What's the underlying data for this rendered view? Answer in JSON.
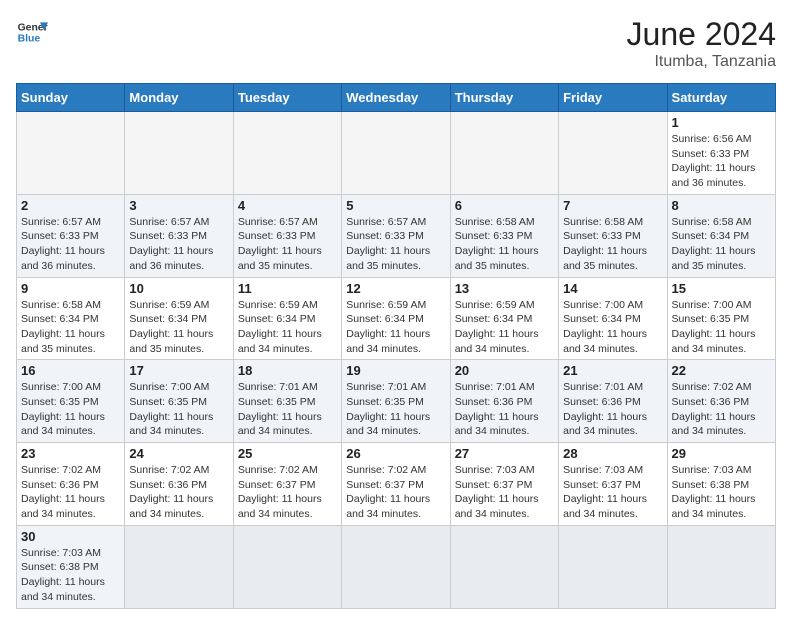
{
  "header": {
    "logo_general": "General",
    "logo_blue": "Blue",
    "month_title": "June 2024",
    "location": "Itumba, Tanzania"
  },
  "weekdays": [
    "Sunday",
    "Monday",
    "Tuesday",
    "Wednesday",
    "Thursday",
    "Friday",
    "Saturday"
  ],
  "days": [
    {
      "num": "",
      "empty": true
    },
    {
      "num": "",
      "empty": true
    },
    {
      "num": "",
      "empty": true
    },
    {
      "num": "",
      "empty": true
    },
    {
      "num": "",
      "empty": true
    },
    {
      "num": "",
      "empty": true
    },
    {
      "num": "1",
      "sunrise": "6:56 AM",
      "sunset": "6:33 PM",
      "daylight": "11 hours and 36 minutes."
    },
    {
      "num": "2",
      "sunrise": "6:57 AM",
      "sunset": "6:33 PM",
      "daylight": "11 hours and 36 minutes."
    },
    {
      "num": "3",
      "sunrise": "6:57 AM",
      "sunset": "6:33 PM",
      "daylight": "11 hours and 36 minutes."
    },
    {
      "num": "4",
      "sunrise": "6:57 AM",
      "sunset": "6:33 PM",
      "daylight": "11 hours and 35 minutes."
    },
    {
      "num": "5",
      "sunrise": "6:57 AM",
      "sunset": "6:33 PM",
      "daylight": "11 hours and 35 minutes."
    },
    {
      "num": "6",
      "sunrise": "6:58 AM",
      "sunset": "6:33 PM",
      "daylight": "11 hours and 35 minutes."
    },
    {
      "num": "7",
      "sunrise": "6:58 AM",
      "sunset": "6:33 PM",
      "daylight": "11 hours and 35 minutes."
    },
    {
      "num": "8",
      "sunrise": "6:58 AM",
      "sunset": "6:34 PM",
      "daylight": "11 hours and 35 minutes."
    },
    {
      "num": "9",
      "sunrise": "6:58 AM",
      "sunset": "6:34 PM",
      "daylight": "11 hours and 35 minutes."
    },
    {
      "num": "10",
      "sunrise": "6:59 AM",
      "sunset": "6:34 PM",
      "daylight": "11 hours and 35 minutes."
    },
    {
      "num": "11",
      "sunrise": "6:59 AM",
      "sunset": "6:34 PM",
      "daylight": "11 hours and 34 minutes."
    },
    {
      "num": "12",
      "sunrise": "6:59 AM",
      "sunset": "6:34 PM",
      "daylight": "11 hours and 34 minutes."
    },
    {
      "num": "13",
      "sunrise": "6:59 AM",
      "sunset": "6:34 PM",
      "daylight": "11 hours and 34 minutes."
    },
    {
      "num": "14",
      "sunrise": "7:00 AM",
      "sunset": "6:34 PM",
      "daylight": "11 hours and 34 minutes."
    },
    {
      "num": "15",
      "sunrise": "7:00 AM",
      "sunset": "6:35 PM",
      "daylight": "11 hours and 34 minutes."
    },
    {
      "num": "16",
      "sunrise": "7:00 AM",
      "sunset": "6:35 PM",
      "daylight": "11 hours and 34 minutes."
    },
    {
      "num": "17",
      "sunrise": "7:00 AM",
      "sunset": "6:35 PM",
      "daylight": "11 hours and 34 minutes."
    },
    {
      "num": "18",
      "sunrise": "7:01 AM",
      "sunset": "6:35 PM",
      "daylight": "11 hours and 34 minutes."
    },
    {
      "num": "19",
      "sunrise": "7:01 AM",
      "sunset": "6:35 PM",
      "daylight": "11 hours and 34 minutes."
    },
    {
      "num": "20",
      "sunrise": "7:01 AM",
      "sunset": "6:36 PM",
      "daylight": "11 hours and 34 minutes."
    },
    {
      "num": "21",
      "sunrise": "7:01 AM",
      "sunset": "6:36 PM",
      "daylight": "11 hours and 34 minutes."
    },
    {
      "num": "22",
      "sunrise": "7:02 AM",
      "sunset": "6:36 PM",
      "daylight": "11 hours and 34 minutes."
    },
    {
      "num": "23",
      "sunrise": "7:02 AM",
      "sunset": "6:36 PM",
      "daylight": "11 hours and 34 minutes."
    },
    {
      "num": "24",
      "sunrise": "7:02 AM",
      "sunset": "6:36 PM",
      "daylight": "11 hours and 34 minutes."
    },
    {
      "num": "25",
      "sunrise": "7:02 AM",
      "sunset": "6:37 PM",
      "daylight": "11 hours and 34 minutes."
    },
    {
      "num": "26",
      "sunrise": "7:02 AM",
      "sunset": "6:37 PM",
      "daylight": "11 hours and 34 minutes."
    },
    {
      "num": "27",
      "sunrise": "7:03 AM",
      "sunset": "6:37 PM",
      "daylight": "11 hours and 34 minutes."
    },
    {
      "num": "28",
      "sunrise": "7:03 AM",
      "sunset": "6:37 PM",
      "daylight": "11 hours and 34 minutes."
    },
    {
      "num": "29",
      "sunrise": "7:03 AM",
      "sunset": "6:38 PM",
      "daylight": "11 hours and 34 minutes."
    },
    {
      "num": "30",
      "sunrise": "7:03 AM",
      "sunset": "6:38 PM",
      "daylight": "11 hours and 34 minutes."
    },
    {
      "num": "",
      "empty": true
    },
    {
      "num": "",
      "empty": true
    },
    {
      "num": "",
      "empty": true
    },
    {
      "num": "",
      "empty": true
    },
    {
      "num": "",
      "empty": true
    },
    {
      "num": "",
      "empty": true
    }
  ],
  "labels": {
    "sunrise": "Sunrise:",
    "sunset": "Sunset:",
    "daylight": "Daylight:"
  }
}
